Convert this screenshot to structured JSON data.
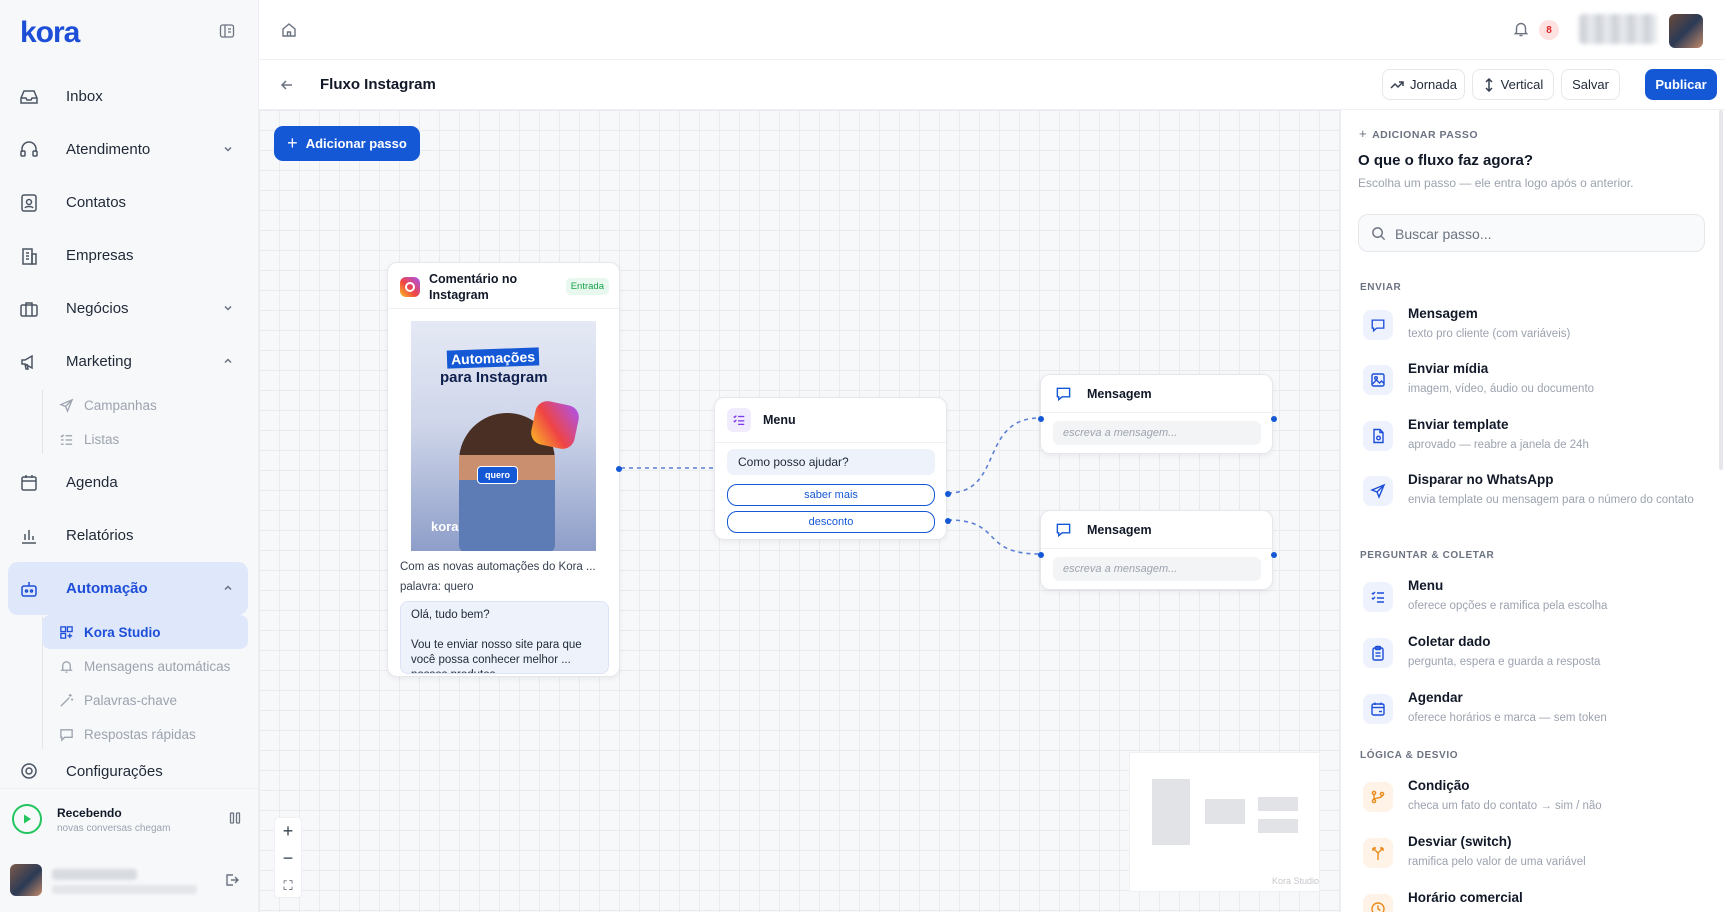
{
  "app": {
    "logo_text": "kora",
    "brand_color": "#1558d6"
  },
  "sidebar": {
    "items": [
      {
        "label": "Inbox",
        "icon": "inbox-icon"
      },
      {
        "label": "Atendimento",
        "icon": "headset-icon",
        "expandable": true
      },
      {
        "label": "Contatos",
        "icon": "contacts-icon"
      },
      {
        "label": "Empresas",
        "icon": "building-icon"
      },
      {
        "label": "Negócios",
        "icon": "briefcase-icon",
        "expandable": true
      },
      {
        "label": "Marketing",
        "icon": "megaphone-icon",
        "expanded": true
      },
      {
        "label": "Agenda",
        "icon": "calendar-icon"
      },
      {
        "label": "Relatórios",
        "icon": "chart-icon"
      },
      {
        "label": "Automação",
        "icon": "bot-icon",
        "expanded": true,
        "active": true
      },
      {
        "label": "Configurações",
        "icon": "gear-icon"
      }
    ],
    "marketing_sub": [
      {
        "label": "Campanhas",
        "icon": "send-icon"
      },
      {
        "label": "Listas",
        "icon": "list-icon"
      }
    ],
    "automacao_sub": [
      {
        "label": "Kora Studio",
        "icon": "studio-icon",
        "active": true
      },
      {
        "label": "Mensagens automáticas",
        "icon": "bell-icon"
      },
      {
        "label": "Palavras-chave",
        "icon": "wand-icon"
      },
      {
        "label": "Respostas rápidas",
        "icon": "chat-icon"
      }
    ],
    "status": {
      "title": "Recebendo",
      "subtitle": "novas conversas chegam"
    }
  },
  "topbar": {
    "notification_count": "8"
  },
  "header": {
    "title": "Fluxo Instagram",
    "buttons": {
      "jornada": "Jornada",
      "vertical": "Vertical",
      "salvar": "Salvar",
      "publicar": "Publicar"
    }
  },
  "canvas": {
    "add_step_label": "Adicionar passo",
    "trigger_node": {
      "title": "Comentário no Instagram",
      "badge": "Entrada",
      "post_headline_1": "Automações",
      "post_headline_2": "para Instagram",
      "post_tag": "quero",
      "post_brand": "kora",
      "caption": "Com as novas automações do Kora ...",
      "keyword": "palavra: quero",
      "reply": "Olá, tudo bem?\n\nVou te enviar nosso site para que você possa conhecer melhor ... nossos produtos"
    },
    "menu_node": {
      "title": "Menu",
      "question": "Como posso ajudar?",
      "options": [
        "saber mais",
        "desconto"
      ]
    },
    "message_nodes": [
      {
        "title": "Mensagem",
        "placeholder": "escreva a mensagem..."
      },
      {
        "title": "Mensagem",
        "placeholder": "escreva a mensagem..."
      }
    ],
    "minimap_label": "Kora Studio",
    "zoom": {
      "in": "+",
      "out": "−",
      "fit": "⛶"
    }
  },
  "panel": {
    "kicker": "ADICIONAR PASSO",
    "title": "O que o fluxo faz agora?",
    "subtitle": "Escolha um passo — ele entra logo após o anterior.",
    "search_placeholder": "Buscar passo...",
    "sections": [
      {
        "title": "ENVIAR",
        "items": [
          {
            "title": "Mensagem",
            "desc": "texto pro cliente (com variáveis)",
            "icon": "message-icon"
          },
          {
            "title": "Enviar mídia",
            "desc": "imagem, vídeo, áudio ou documento",
            "icon": "image-icon"
          },
          {
            "title": "Enviar template",
            "desc": "aprovado — reabre a janela de 24h",
            "icon": "template-icon"
          },
          {
            "title": "Disparar no WhatsApp",
            "desc": "envia template ou mensagem para o número do contato",
            "icon": "send-icon"
          }
        ]
      },
      {
        "title": "PERGUNTAR & COLETAR",
        "items": [
          {
            "title": "Menu",
            "desc": "oferece opções e ramifica pela escolha",
            "icon": "menu-list-icon"
          },
          {
            "title": "Coletar dado",
            "desc": "pergunta, espera e guarda a resposta",
            "icon": "clipboard-icon"
          },
          {
            "title": "Agendar",
            "desc": "oferece horários e marca — sem token",
            "icon": "calendar-icon"
          }
        ]
      },
      {
        "title": "LÓGICA & DESVIO",
        "items": [
          {
            "title": "Condição",
            "desc": "checa um fato do contato → sim / não",
            "icon": "branch-icon"
          },
          {
            "title": "Desviar (switch)",
            "desc": "ramifica pelo valor de uma variável",
            "icon": "split-icon"
          },
          {
            "title": "Horário comercial",
            "desc": "",
            "icon": "clock-icon"
          }
        ]
      }
    ]
  }
}
